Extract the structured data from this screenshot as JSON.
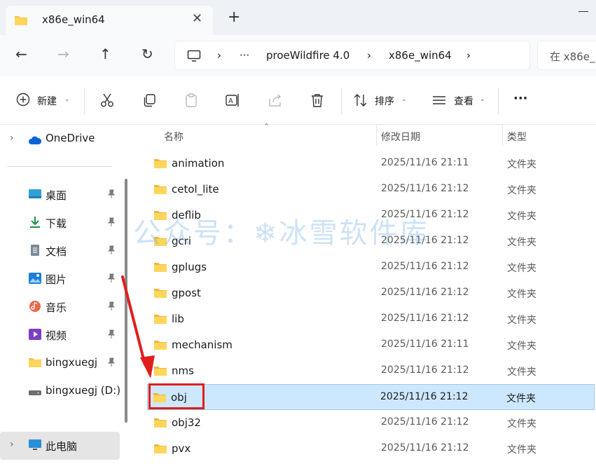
{
  "tab": {
    "title": "x86e_win64",
    "close_glyph": "✕",
    "new_tab_glyph": "+"
  },
  "nav": {
    "back_glyph": "←",
    "forward_glyph": "→",
    "up_glyph": "↑",
    "refresh_glyph": "↻",
    "address": {
      "separator": "›",
      "overflow": "···",
      "segments": [
        "proeWildfire 4.0",
        "x86e_win64"
      ]
    },
    "search_placeholder": "在 x86e_"
  },
  "toolbar": {
    "new_label": "新建",
    "sort_label": "排序",
    "view_label": "查看",
    "more_glyph": "···",
    "caret": "⌄"
  },
  "sidebar": {
    "onedrive": "OneDrive",
    "items": [
      {
        "label": "桌面",
        "icon": "desktop-icon"
      },
      {
        "label": "下载",
        "icon": "download-icon"
      },
      {
        "label": "文档",
        "icon": "document-icon"
      },
      {
        "label": "图片",
        "icon": "pictures-icon"
      },
      {
        "label": "音乐",
        "icon": "music-icon"
      },
      {
        "label": "视频",
        "icon": "video-icon"
      },
      {
        "label": "bingxuegj",
        "icon": "folder-icon"
      },
      {
        "label": "bingxuegj (D:)",
        "icon": "drive-icon"
      }
    ],
    "this_pc": "此电脑"
  },
  "columns": {
    "name": "名称",
    "modified": "修改日期",
    "type": "类型"
  },
  "files": [
    {
      "name": "animation",
      "date": "2025/11/16 21:11",
      "type": "文件夹"
    },
    {
      "name": "cetol_lite",
      "date": "2025/11/16 21:12",
      "type": "文件夹"
    },
    {
      "name": "deflib",
      "date": "2025/11/16 21:12",
      "type": "文件夹"
    },
    {
      "name": "gcri",
      "date": "2025/11/16 21:12",
      "type": "文件夹"
    },
    {
      "name": "gplugs",
      "date": "2025/11/16 21:12",
      "type": "文件夹"
    },
    {
      "name": "gpost",
      "date": "2025/11/16 21:12",
      "type": "文件夹"
    },
    {
      "name": "lib",
      "date": "2025/11/16 21:12",
      "type": "文件夹"
    },
    {
      "name": "mechanism",
      "date": "2025/11/16 21:11",
      "type": "文件夹"
    },
    {
      "name": "nms",
      "date": "2025/11/16 21:12",
      "type": "文件夹"
    },
    {
      "name": "obj",
      "date": "2025/11/16 21:12",
      "type": "文件夹",
      "selected": true
    },
    {
      "name": "obj32",
      "date": "2025/11/16 21:12",
      "type": "文件夹"
    },
    {
      "name": "pvx",
      "date": "2025/11/16 21:12",
      "type": "文件夹"
    }
  ],
  "watermark": "公众号：❄冰雪软件库",
  "colors": {
    "accent": "#0067c0",
    "selection": "#cde8fe",
    "annotation_red": "#e01e1e",
    "folder_yellow": "#f7c64a"
  }
}
